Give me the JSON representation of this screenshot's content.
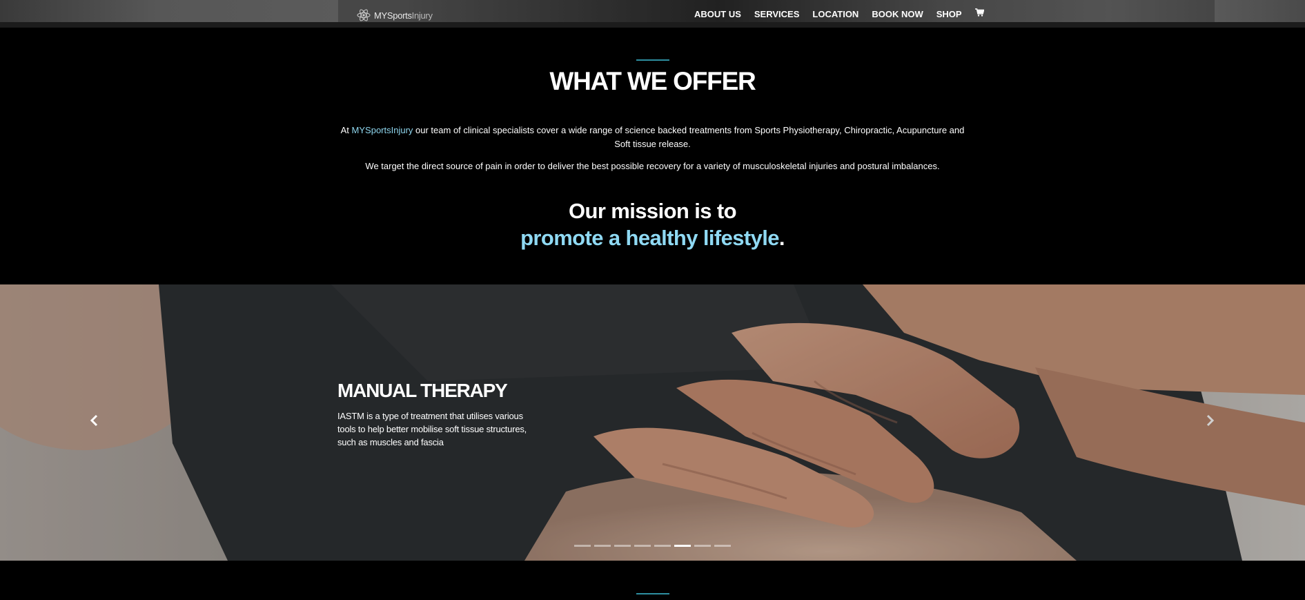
{
  "header": {
    "logo": {
      "brand_bold": "MYSports",
      "brand_light": "Injury",
      "icon": "atom-logo-icon"
    },
    "nav": [
      "ABOUT US",
      "SERVICES",
      "LOCATION",
      "BOOK NOW",
      "SHOP"
    ],
    "cart_icon": "shopping-cart-icon"
  },
  "offer": {
    "title": "WHAT WE OFFER",
    "para1_prefix": "At ",
    "para1_brand": "MYSportsInjury",
    "para1_rest": " our team of clinical specialists cover a wide range of science backed treatments from Sports Physiotherapy, Chiropractic, Acupuncture and Soft tissue release.",
    "para2": "We target the direct source of pain in order to deliver the best possible recovery for a variety of musculoskeletal injuries and postural imbalances.",
    "mission_line1": "Our mission is to",
    "mission_highlight": "promote a healthy lifestyle",
    "mission_end": "."
  },
  "slider": {
    "title": "MANUAL THERAPY",
    "text": "IASTM is a type of treatment that utilises various tools to help better mobilise soft tissue structures, such as muscles and fascia",
    "prev_icon": "chevron-left-icon",
    "next_icon": "chevron-right-icon",
    "dot_count": 8,
    "active_dot": 6
  },
  "colors": {
    "accent_line": "#2e8fa1",
    "brand_link": "#8fd6ee",
    "mission_highlight": "#8fd9f3",
    "background": "#000000"
  }
}
